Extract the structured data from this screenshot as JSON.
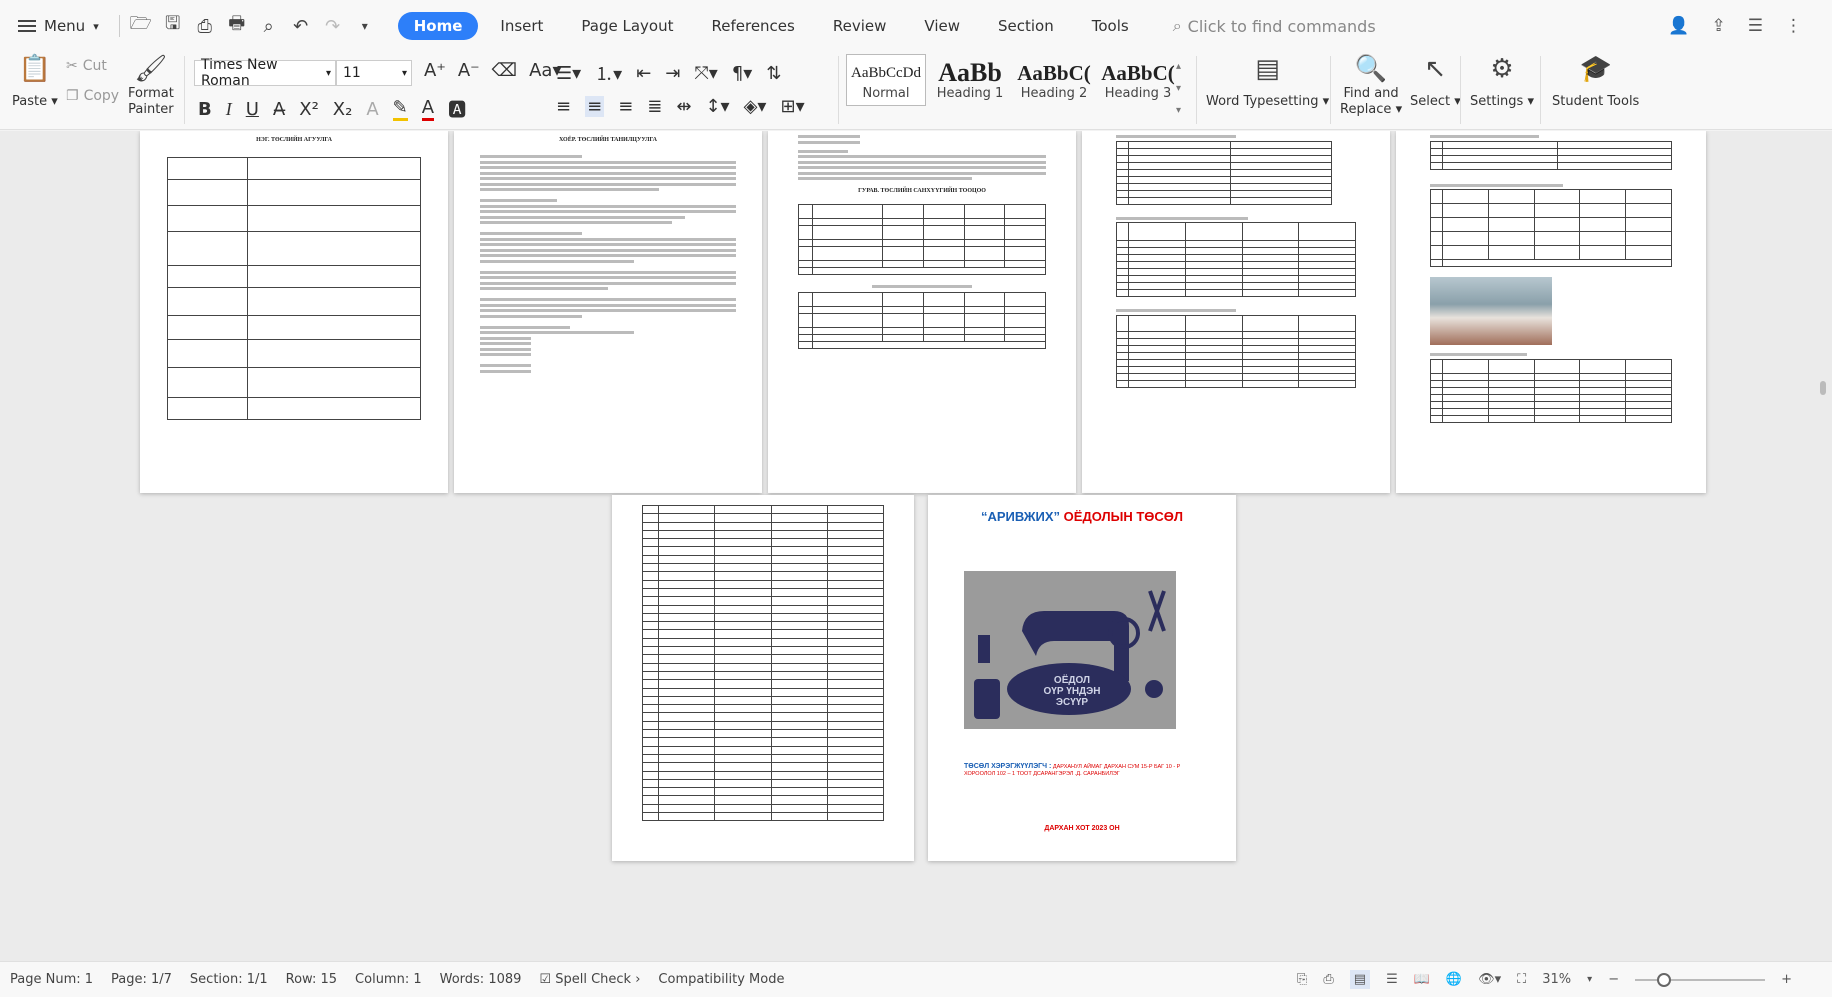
{
  "menubar": {
    "menu_label": "Menu",
    "tabs": [
      "Home",
      "Insert",
      "Page Layout",
      "References",
      "Review",
      "View",
      "Section",
      "Tools"
    ],
    "active_tab": "Home",
    "search_placeholder": "Click to find commands"
  },
  "ribbon": {
    "paste": "Paste",
    "cut": "Cut",
    "copy": "Copy",
    "format_painter_1": "Format",
    "format_painter_2": "Painter",
    "font_name": "Times New Roman",
    "font_size": "11",
    "styles": [
      {
        "preview": "AaBbCcDd",
        "label": "Normal"
      },
      {
        "preview": "AaBb",
        "label": "Heading 1"
      },
      {
        "preview": "AaBbC(",
        "label": "Heading 2"
      },
      {
        "preview": "AaBbC(",
        "label": "Heading 3"
      }
    ],
    "word_typesetting": "Word Typesetting",
    "find_replace_1": "Find and",
    "find_replace_2": "Replace",
    "select": "Select",
    "settings": "Settings",
    "student_tools": "Student Tools"
  },
  "pages": {
    "p1_title": "НЭГ. ТӨСЛИЙН АГУУЛГА",
    "p2_title": "ХОЁР. ТӨСЛИЙН ТАНИЛЦУУЛГА",
    "p3_title": "ГУРАВ. ТӨСЛИЙН САНХҮҮГИЙН ТООЦОО",
    "cover_title_q": "“АРИВЖИХ”",
    "cover_title_rest": " ОЁДОЛЫН ТӨСӨЛ",
    "cover_img_text_1": "ОЁДОЛ",
    "cover_img_text_2": "ОҮР ҮНДЭН",
    "cover_img_text_3": "ЭСҮҮР",
    "cover_author_label": "ТӨСӨЛ ХЭРЭГЖҮҮЛЭГЧ :",
    "cover_author_text": "ДАРХАНУЛ АЙМАГ ДАРХАН СУМ 15-Р БАГ 10 - Р ХОРООЛОЛ 102 – 1 ТООТ ДСАРАНГЭРЭЛ .Д. САРАНБИЛЭГ",
    "cover_footer": "ДАРХАН ХОТ 2023 ОН"
  },
  "status": {
    "page_num": "Page Num: 1",
    "page": "Page: 1/7",
    "section": "Section: 1/1",
    "row": "Row: 15",
    "column": "Column: 1",
    "words": "Words: 1089",
    "spell": "Spell Check",
    "compat": "Compatibility Mode",
    "zoom": "31%"
  }
}
